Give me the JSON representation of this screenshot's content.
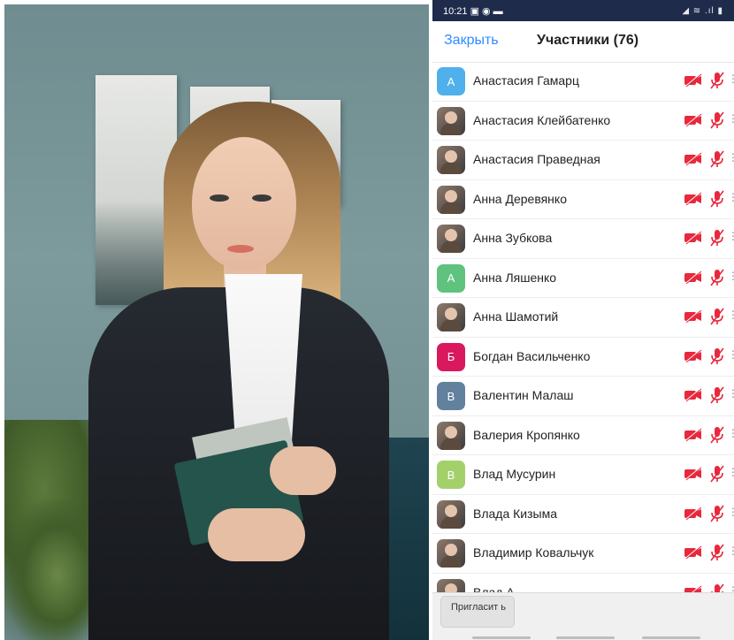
{
  "status_bar": {
    "time": "10:21 ▣ ◉ ▬",
    "indicators": "◢ ≋ .ıl ▮"
  },
  "header": {
    "close_label": "Закрыть",
    "title": "Участники (76)"
  },
  "participants": [
    {
      "name": "Анастасия Гамарц",
      "initial": "A",
      "color": "#4fb0ec"
    },
    {
      "name": "Анастасия Клейбатенко",
      "initial": "",
      "color": "#c9b7a6"
    },
    {
      "name": "Анастасия Праведная",
      "initial": "",
      "color": "#55667a"
    },
    {
      "name": "Анна Деревянко",
      "initial": "",
      "color": "#2c3246"
    },
    {
      "name": "Анна Зубкова",
      "initial": "",
      "color": "#b99b84"
    },
    {
      "name": "Анна Ляшенко",
      "initial": "A",
      "color": "#5fc27e"
    },
    {
      "name": "Анна Шамотий",
      "initial": "",
      "color": "#6f8a4e"
    },
    {
      "name": "Богдан Васильченко",
      "initial": "Б",
      "color": "#d9185e"
    },
    {
      "name": "Валентин Малаш",
      "initial": "B",
      "color": "#62819e"
    },
    {
      "name": "Валерия Кропянко",
      "initial": "",
      "color": "#000000"
    },
    {
      "name": "Влад Мусурин",
      "initial": "B",
      "color": "#a4d06c"
    },
    {
      "name": "Влада Кизыма",
      "initial": "",
      "color": "#000000"
    },
    {
      "name": "Владимир Ковальчук",
      "initial": "",
      "color": "#4b5c68"
    },
    {
      "name": "Влад А...",
      "initial": "",
      "color": "#b8a090"
    }
  ],
  "icons": {
    "camera_off": "video-off-icon",
    "mic_off": "mic-off-icon",
    "muted_color": "#e8283c"
  },
  "footer": {
    "invite_label": "Пригласит ь"
  }
}
